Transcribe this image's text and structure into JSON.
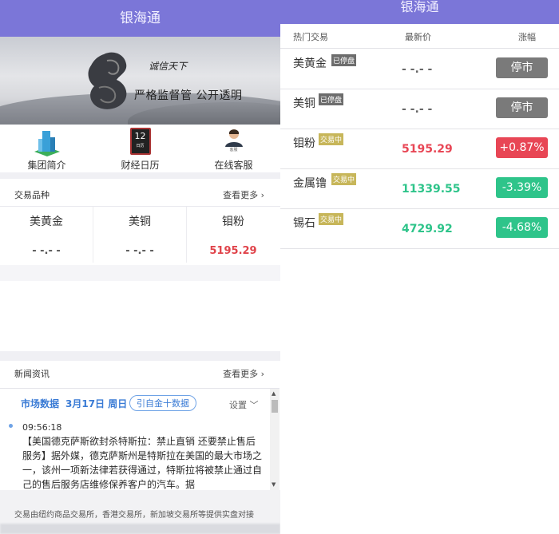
{
  "left": {
    "title": "银海通",
    "banner": {
      "slogan_top": "诚信天下",
      "slogan": "严格监督管 公开透明"
    },
    "quick_links": [
      {
        "label": "集团简介",
        "icon": "building-icon"
      },
      {
        "label": "财经日历",
        "icon": "calendar-icon",
        "icon_num": "12",
        "icon_sub": "日历"
      },
      {
        "label": "在线客服",
        "icon": "support-agent-icon",
        "icon_sub": "客服"
      }
    ],
    "products_section": {
      "title": "交易品种",
      "more": "查看更多 ›"
    },
    "products": [
      {
        "name": "美黄金",
        "value": "- -.- -"
      },
      {
        "name": "美铜",
        "value": "- -.- -"
      },
      {
        "name": "钼粉",
        "value": "5195.29"
      }
    ],
    "news_section": {
      "title": "新闻资讯",
      "more": "查看更多 ›"
    },
    "news_panel": {
      "header": "市场数据",
      "date": "3月17日 周日",
      "badge": "引自金十数据",
      "settings": "设置 ﹀",
      "time": "09:56:18",
      "text": "【美国德克萨斯欲封杀特斯拉：禁止直销 还要禁止售后服务】据外媒，德克萨斯州是特斯拉在美国的最大市场之一，该州一项新法律若获得通过，特斯拉将被禁止通过自己的售后服务店维修保养客户的汽车。据"
    },
    "disclaimer": "交易由纽约商品交易所，香港交易所，新加坡交易所等提供实盘对接"
  },
  "right": {
    "title": "银海通",
    "columns": {
      "name": "热门交易",
      "price": "最新价",
      "change": "涨幅"
    },
    "rows": [
      {
        "name": "美黄金",
        "tag": "已停盘",
        "tag_type": "stop",
        "price": "- -.- -",
        "change": "停市",
        "color": "#7a7a7a"
      },
      {
        "name": "美铜",
        "tag": "已停盘",
        "tag_type": "stop",
        "price": "- -.- -",
        "change": "停市",
        "color": "#7a7a7a"
      },
      {
        "name": "钼粉",
        "tag": "交易中",
        "tag_type": "live",
        "price": "5195.29",
        "change": "+0.87%",
        "color": "#e84655"
      },
      {
        "name": "金属镥",
        "tag": "交易中",
        "tag_type": "live",
        "price": "11339.55",
        "change": "-3.39%",
        "color": "#2ec48a"
      },
      {
        "name": "锡石",
        "tag": "交易中",
        "tag_type": "live",
        "price": "4729.92",
        "change": "-4.68%",
        "color": "#2ec48a"
      }
    ]
  }
}
